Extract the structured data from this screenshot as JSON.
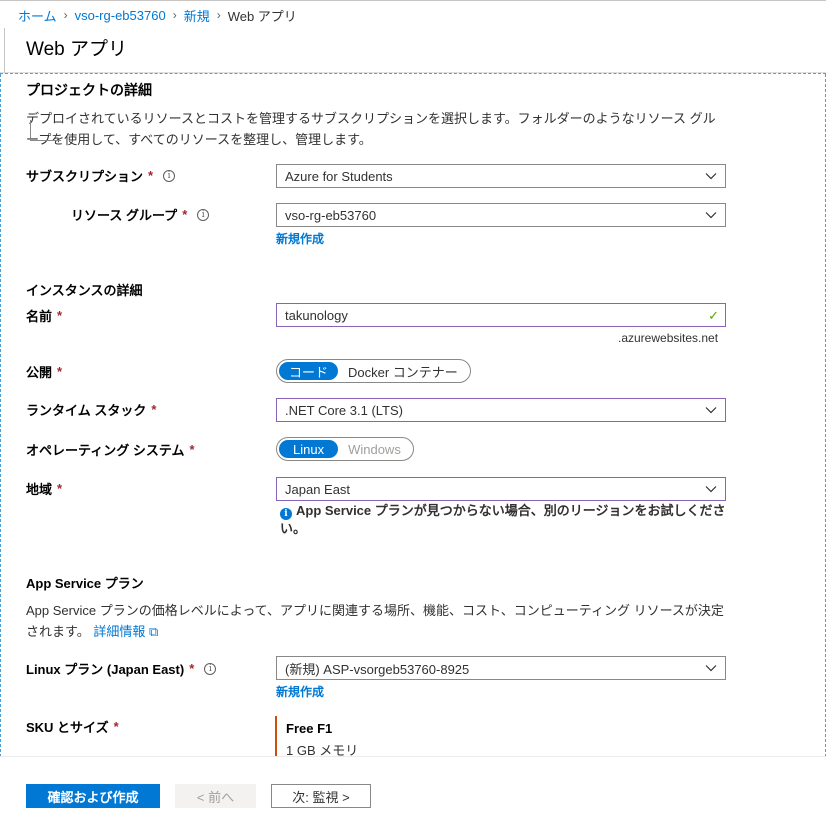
{
  "breadcrumb": {
    "items": [
      {
        "label": "ホーム"
      },
      {
        "label": "vso-rg-eb53760"
      },
      {
        "label": "新規"
      },
      {
        "label": "Web アプリ"
      }
    ]
  },
  "page_title": "Web アプリ",
  "project": {
    "title": "プロジェクトの詳細",
    "desc_line1": "デプロイされているリソースとコストを管理するサブスクリプションを選択します。フォルダーのようなリソース グル",
    "desc_line2": "ープを使用して、すべてのリソースを整理し、管理します。",
    "subscription_label": "サブスクリプション",
    "subscription_value": "Azure for Students",
    "resource_group_label": "リソース グループ",
    "resource_group_value": "vso-rg-eb53760",
    "create_new": "新規作成"
  },
  "instance": {
    "title": "インスタンスの詳細",
    "name_label": "名前",
    "name_value": "takunology",
    "name_suffix": ".azurewebsites.net",
    "publish_label": "公開",
    "publish_options": [
      "コード",
      "Docker コンテナー"
    ],
    "runtime_label": "ランタイム スタック",
    "runtime_value": ".NET Core 3.1 (LTS)",
    "os_label": "オペレーティング システム",
    "os_options": [
      "Linux",
      "Windows"
    ],
    "region_label": "地域",
    "region_value": "Japan East",
    "region_info_line1": "App Service プランが見つからない場合、別のリージョンをお試しくださ",
    "region_info_line2": "い。"
  },
  "plan": {
    "title": "App Service プラン",
    "desc_line1": "App Service プランの価格レベルによって、アプリに関連する場所、機能、コスト、コンピューティング リソースが決定",
    "desc_line2": "されます。",
    "more_info": "詳細情報",
    "linux_plan_label": "Linux プラン (Japan East)",
    "linux_plan_value": "(新規) ASP-vsorgeb53760-8925",
    "create_new": "新規作成",
    "sku_label": "SKU とサイズ",
    "sku_name": "Free F1",
    "sku_memory": "1 GB メモリ"
  },
  "footer": {
    "review_create": "確認および作成",
    "previous": "< 前へ",
    "next": "次: 監視 >"
  },
  "required_mark": "*",
  "colors": {
    "accent": "#0078d4",
    "required": "#a4262c",
    "focus_border": "#8764b8",
    "valid_check": "#57a300",
    "sku_bar": "#ca5010"
  }
}
